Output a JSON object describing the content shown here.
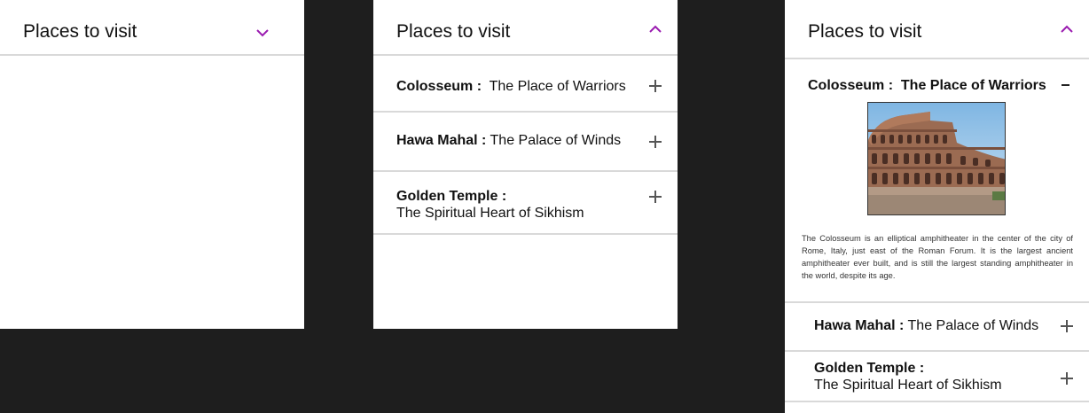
{
  "accordion_title": "Places to visit",
  "places": [
    {
      "name": "Colosseum :",
      "tagline": "The Place of Warriors"
    },
    {
      "name": "Hawa Mahal :",
      "tagline": "The Palace of Winds"
    },
    {
      "name": "Golden Temple :",
      "tagline": "The Spiritual Heart of Sikhism"
    }
  ],
  "expanded": {
    "name": "Colosseum :",
    "tagline": "The Place of Warriors",
    "description": "The Colosseum is an elliptical amphitheater in the center of the city of Rome, Italy, just east of the Roman Forum. It is the largest ancient amphitheater ever built, and is still the  largest standing amphitheater in the world, despite its age."
  },
  "colors": {
    "accent": "#9a1bb0",
    "background": "#1e1e1e",
    "panel": "#ffffff",
    "divider": "#d9d9d9"
  },
  "icons": {
    "collapsed": "chevron-down-icon",
    "expanded": "chevron-up-icon",
    "expand_item": "plus-icon",
    "collapse_item": "minus-icon"
  }
}
